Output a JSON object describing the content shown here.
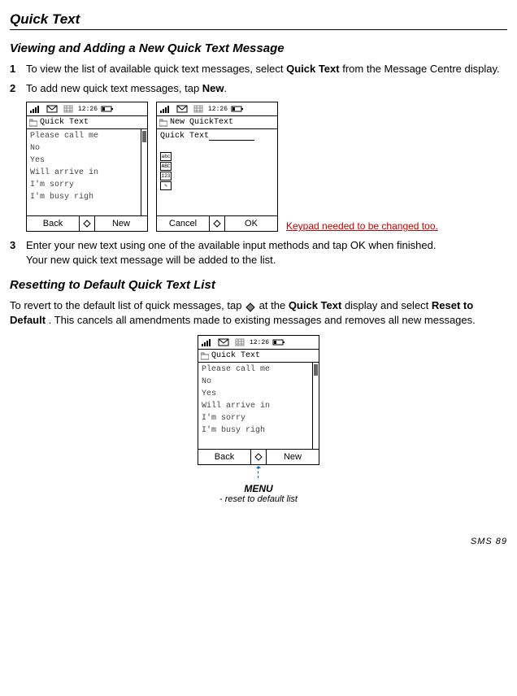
{
  "page_title": "Quick Text",
  "section1_heading": "Viewing and Adding a New Quick Text Message",
  "step1": {
    "num": "1",
    "prefix": "To view the list of available quick text messages, select ",
    "bold": "Quick Text",
    "suffix": " from the Message Centre display."
  },
  "step2": {
    "num": "2",
    "prefix": "To add new quick text messages, tap ",
    "bold": "New",
    "suffix": "."
  },
  "phoneA": {
    "time": "12:26",
    "title": "Quick Text",
    "items": [
      "Please call me",
      "No",
      "Yes",
      "Will arrive in",
      "I'm sorry",
      "I'm busy righ"
    ],
    "left": "Back",
    "right": "New"
  },
  "phoneB": {
    "time": "12:26",
    "title": "New QuickText",
    "entry": "Quick Text",
    "left": "Cancel",
    "right": "OK"
  },
  "red_note": "Keypad needed to be changed too.",
  "step3": {
    "num": "3",
    "line1": "Enter your new text using one of the available input methods and tap OK when finished.",
    "line2": "Your new quick text message will be added to the list."
  },
  "section2_heading": "Resetting to Default Quick Text List",
  "reset_para": {
    "p1": "To revert to the default list of quick messages, tap ",
    "p2": " at the ",
    "b1": "Quick Text",
    "p3": " display and select ",
    "b2": "Reset to Default",
    "p4": " . This cancels all amendments made to existing messages and removes all new messages."
  },
  "phoneC": {
    "time": "12:26",
    "title": "Quick Text",
    "items": [
      "Please call me",
      "No",
      "Yes",
      "Will arrive in",
      "I'm sorry",
      "I'm busy righ"
    ],
    "left": "Back",
    "right": "New"
  },
  "menu_caption": {
    "main": "MENU",
    "sub": "- reset to default list"
  },
  "footer": "SMS  89"
}
